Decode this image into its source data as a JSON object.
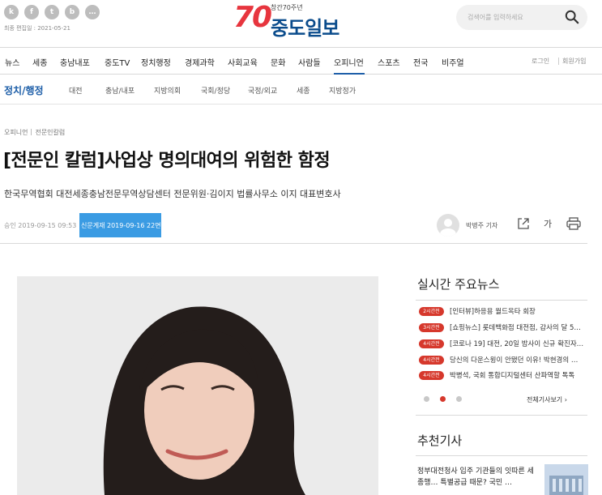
{
  "header": {
    "social": [
      "k",
      "f",
      "t",
      "b",
      "…"
    ],
    "last_edited": "최종 편집일 : 2021-05-21",
    "logo_number": "70",
    "logo_sub": "창간70주년",
    "logo_name": "중도일보",
    "search_placeholder": "검색어를 입력하세요"
  },
  "nav": {
    "items": [
      "뉴스",
      "세종",
      "충남내포",
      "중도TV",
      "정치행정",
      "경제과학",
      "사회교육",
      "문화",
      "사람들",
      "오피니언",
      "스포츠",
      "전국",
      "비주얼"
    ],
    "active": "오피니언",
    "login": "로그인",
    "signup": "회원가입"
  },
  "subnav": {
    "title": "정치/행정",
    "items": [
      "대전",
      "충남/내포",
      "지방의회",
      "국회/정당",
      "국정/외교",
      "세종",
      "지방정가"
    ]
  },
  "article": {
    "breadcrumb": [
      "오피니언",
      "전문인칼럼"
    ],
    "headline": "[전문인 칼럼]사업상 명의대여의 위험한 함정",
    "subtitle": "한국무역협회 대전세종충남전문무역상담센터 전문위원·김이지 법률사무소 이지 대표변호사",
    "approved": "승인 2019-09-15 09:53",
    "print_date": "신문게재 2019-09-16 22면",
    "reporter": "박병주 기자",
    "font_label": "가"
  },
  "sidebar": {
    "realtime_title": "실시간 주요뉴스",
    "news": [
      {
        "badge": "2시간전",
        "text": "[인터뷰]하응용 월드옥타 회장"
      },
      {
        "badge": "3시간전",
        "text": "[쇼핑뉴스] 롯데백화점 대전점, 감사의 달 5…"
      },
      {
        "badge": "4시간전",
        "text": "[코로나 19] 대전, 20일 밤사이 신규 확진자…"
      },
      {
        "badge": "4시간전",
        "text": "당신의 다운스윙이 안됐던 이유! 박현경의 …"
      },
      {
        "badge": "4시간전",
        "text": "박병석, 국회 통합디지털센터 산파역할 톡톡"
      }
    ],
    "all_link": "전체기사보기",
    "recommended_title": "추천기사",
    "recommended_text": "정부대전청사 입주 기관들의 잇따른 세종행… 특별공급 때문? 국민 …"
  },
  "colors": {
    "accent": "#1d5ea8",
    "badge": "#d6382c",
    "highlight": "#3a9be3"
  }
}
